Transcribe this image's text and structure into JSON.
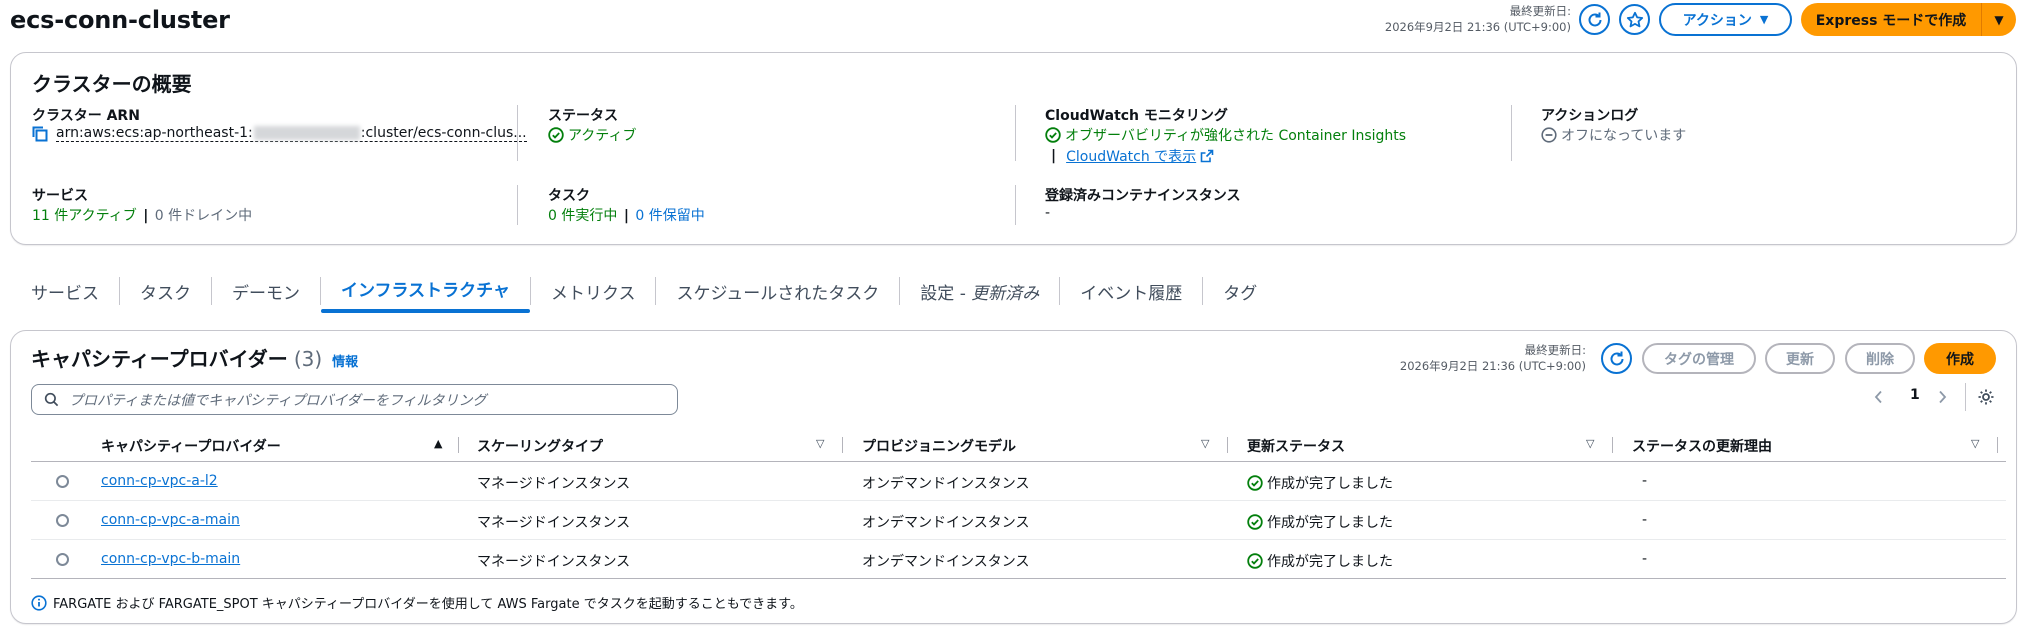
{
  "header": {
    "title": "ecs-conn-cluster",
    "updated_label": "最終更新日:",
    "updated_value": "2026年9月2日 21:36 (UTC+9:00)",
    "action_button": "アクション",
    "express_button": "Express モードで作成"
  },
  "overview": {
    "title": "クラスターの概要",
    "arn_label": "クラスター ARN",
    "arn_prefix": "arn:aws:ecs:ap-northeast-1:",
    "arn_suffix": ":cluster/ecs-conn-clus...",
    "status_label": "ステータス",
    "status_value": "アクティブ",
    "cloudwatch_label": "CloudWatch モニタリング",
    "cloudwatch_value": "オブザーバビリティが強化された Container Insights",
    "cloudwatch_sep": "|",
    "cloudwatch_link": "CloudWatch で表示",
    "actionlog_label": "アクションログ",
    "actionlog_value": "オフになっています",
    "services_label": "サービス",
    "services_active": "11 件アクティブ",
    "services_sep": "|",
    "services_draining": "0 件ドレイン中",
    "tasks_label": "タスク",
    "tasks_running": "0 件実行中",
    "tasks_sep": "|",
    "tasks_pending": "0 件保留中",
    "instances_label": "登録済みコンテナインスタンス",
    "instances_value": "-"
  },
  "tabs": [
    {
      "label": "サービス"
    },
    {
      "label": "タスク"
    },
    {
      "label": "デーモン"
    },
    {
      "label": "インフラストラクチャ",
      "active": true
    },
    {
      "label": "メトリクス"
    },
    {
      "label": "スケジュールされたタスク"
    },
    {
      "label": "設定 -",
      "suffix": "更新済み"
    },
    {
      "label": "イベント履歴"
    },
    {
      "label": "タグ"
    }
  ],
  "cp": {
    "title": "キャパシティープロバイダー",
    "count": "(3)",
    "info": "情報",
    "updated_label": "最終更新日:",
    "updated_value": "2026年9月2日 21:36 (UTC+9:00)",
    "manage_tags": "タグの管理",
    "update": "更新",
    "delete": "削除",
    "create": "作成",
    "filter_placeholder": "プロパティまたは値でキャパシティプロバイダーをフィルタリング",
    "page": "1",
    "columns": [
      "キャパシティープロバイダー",
      "スケーリングタイプ",
      "プロビジョニングモデル",
      "更新ステータス",
      "ステータスの更新理由"
    ],
    "rows": [
      {
        "name": "conn-cp-vpc-a-l2",
        "scaling": "マネージドインスタンス",
        "model": "オンデマンドインスタンス",
        "status": "作成が完了しました",
        "reason": "-"
      },
      {
        "name": "conn-cp-vpc-a-main",
        "scaling": "マネージドインスタンス",
        "model": "オンデマンドインスタンス",
        "status": "作成が完了しました",
        "reason": "-"
      },
      {
        "name": "conn-cp-vpc-b-main",
        "scaling": "マネージドインスタンス",
        "model": "オンデマンドインスタンス",
        "status": "作成が完了しました",
        "reason": "-"
      }
    ],
    "footer_note": "FARGATE および FARGATE_SPOT キャパシティープロバイダーを使用して AWS Fargate でタスクを起動することもできます。"
  }
}
